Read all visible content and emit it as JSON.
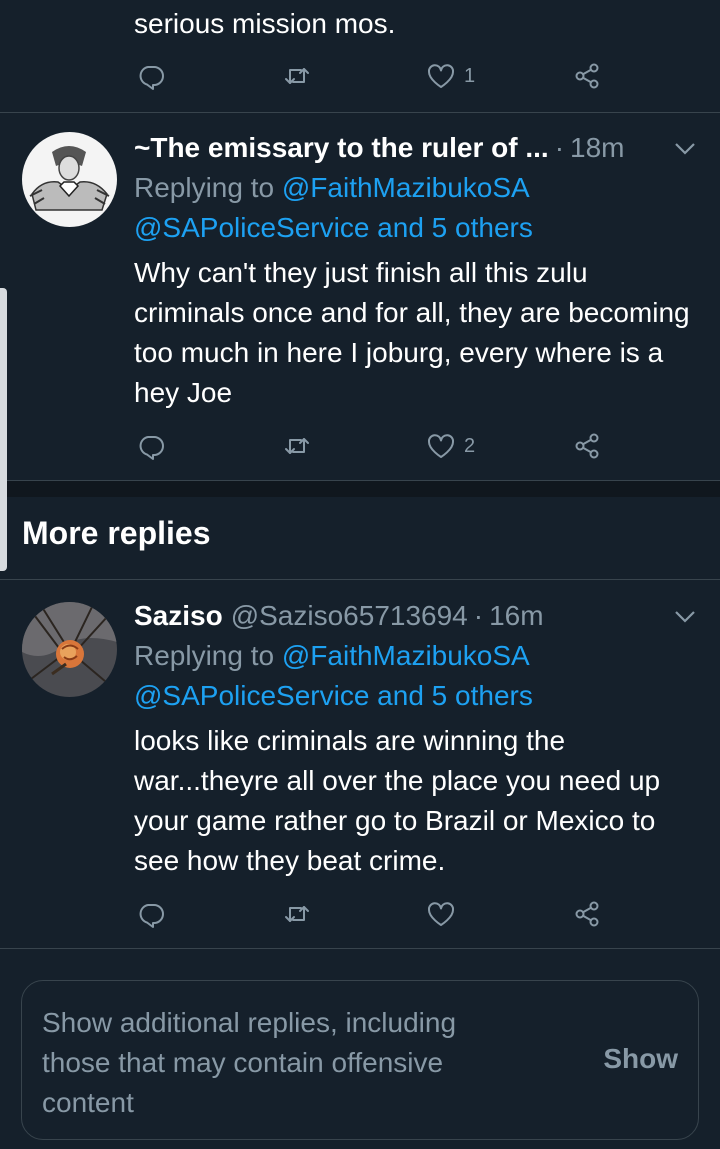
{
  "partial_tweet": {
    "text": "serious mission mos.",
    "likes": "1"
  },
  "tweet1": {
    "name": "~The emissary to the ruler of ...",
    "time": "18m",
    "replying_prefix": "Replying to",
    "replying_to": "@FaithMazibukoSA",
    "replying_more": "@SAPoliceService and 5 others",
    "body": "Why can't they just finish all this zulu criminals once and for all, they are becoming too much in here I joburg, every where is a hey Joe",
    "likes": "2"
  },
  "section": {
    "title": "More replies"
  },
  "tweet2": {
    "name": "Saziso",
    "handle": "@Saziso65713694",
    "time": "16m",
    "replying_prefix": "Replying to",
    "replying_to": "@FaithMazibukoSA",
    "replying_more": "@SAPoliceService and 5 others",
    "body": "looks like criminals are winning the war...theyre all over the place you need up your game rather go to Brazil or Mexico to see how they beat crime."
  },
  "show_more": {
    "message": "Show additional replies, including those that may contain offensive content",
    "button": "Show"
  },
  "icons": {
    "reply": "reply-icon",
    "retweet": "retweet-icon",
    "like": "heart-icon",
    "share": "share-icon",
    "menu": "chevron-down-icon"
  },
  "colors": {
    "background": "#15202b",
    "divider": "#38444d",
    "muted": "#8899a6",
    "link": "#1da1f2",
    "text": "#ffffff"
  }
}
